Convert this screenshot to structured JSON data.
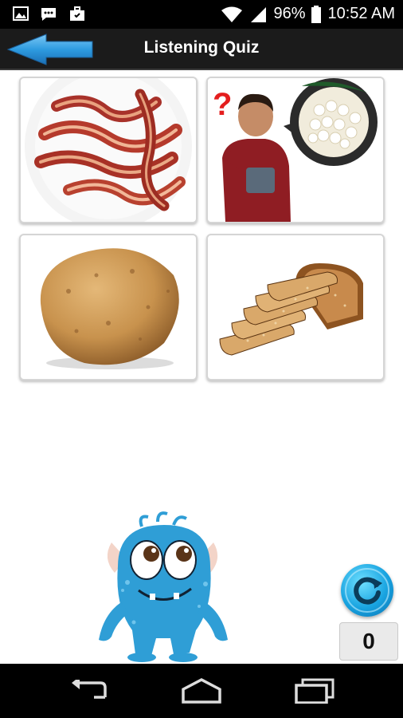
{
  "status_bar": {
    "battery": "96%",
    "time": "10:52 AM",
    "notification_icons": [
      "image-icon",
      "message-icon",
      "briefcase-icon"
    ],
    "signal_icons": [
      "wifi-icon",
      "cell-signal-icon",
      "battery-icon"
    ]
  },
  "header": {
    "title": "Listening Quiz",
    "back_icon": "back-arrow-icon"
  },
  "quiz": {
    "choices": [
      {
        "image": "bacon"
      },
      {
        "image": "boy-pointing-at-cottage-cheese"
      },
      {
        "image": "potato"
      },
      {
        "image": "bread-loaf"
      }
    ]
  },
  "controls": {
    "replay_icon": "replay-icon",
    "score": "0",
    "mascot": "blue-monster-mascot"
  },
  "nav_bar": {
    "icons": [
      "back-nav-icon",
      "home-nav-icon",
      "recents-nav-icon"
    ]
  },
  "colors": {
    "header_bg": "#1b1b1b",
    "arrow_blue": "#2e9be0",
    "replay_blue": "#18a3e0",
    "monster_blue": "#2f9ed6"
  }
}
